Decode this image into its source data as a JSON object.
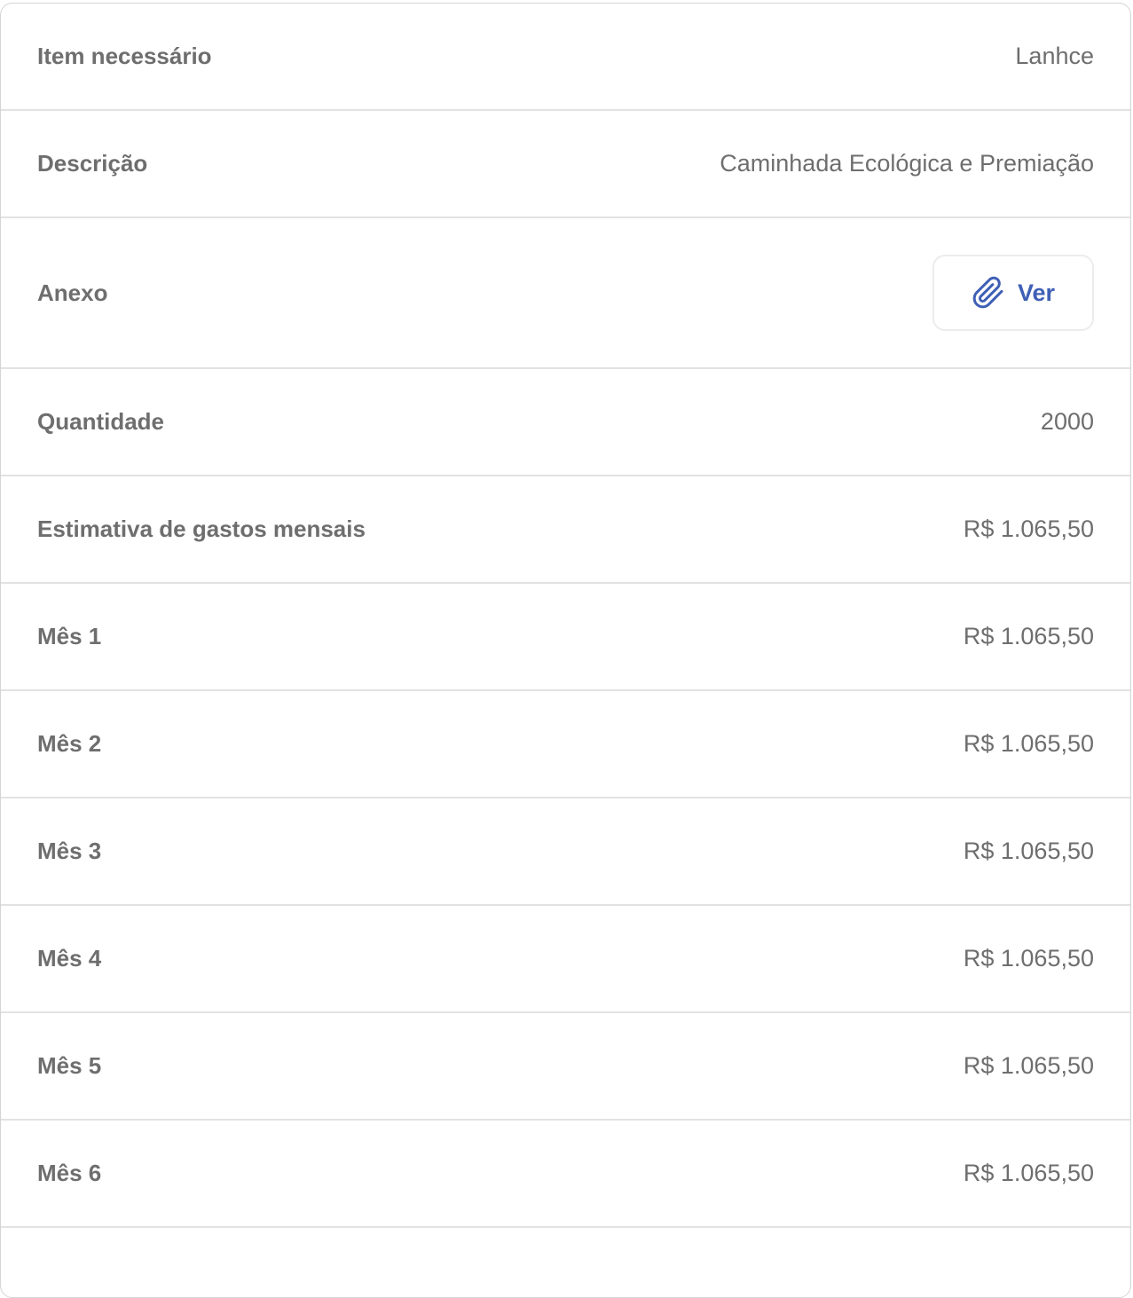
{
  "details": {
    "rows": [
      {
        "label": "Item necessário",
        "value": "Lanhce"
      },
      {
        "label": "Descrição",
        "value": "Caminhada Ecológica e Premiação"
      }
    ],
    "attachment": {
      "label": "Anexo",
      "button_label": "Ver",
      "icon": "paperclip-icon",
      "accent_color": "#3f5fb6"
    },
    "quantity": {
      "label": "Quantidade",
      "value": "2000"
    },
    "monthly_estimate": {
      "label": "Estimativa de gastos mensais",
      "value": "R$ 1.065,50"
    },
    "months": [
      {
        "label": "Mês 1",
        "value": "R$ 1.065,50"
      },
      {
        "label": "Mês 2",
        "value": "R$ 1.065,50"
      },
      {
        "label": "Mês 3",
        "value": "R$ 1.065,50"
      },
      {
        "label": "Mês 4",
        "value": "R$ 1.065,50"
      },
      {
        "label": "Mês 5",
        "value": "R$ 1.065,50"
      },
      {
        "label": "Mês 6",
        "value": "R$ 1.065,50"
      }
    ]
  }
}
